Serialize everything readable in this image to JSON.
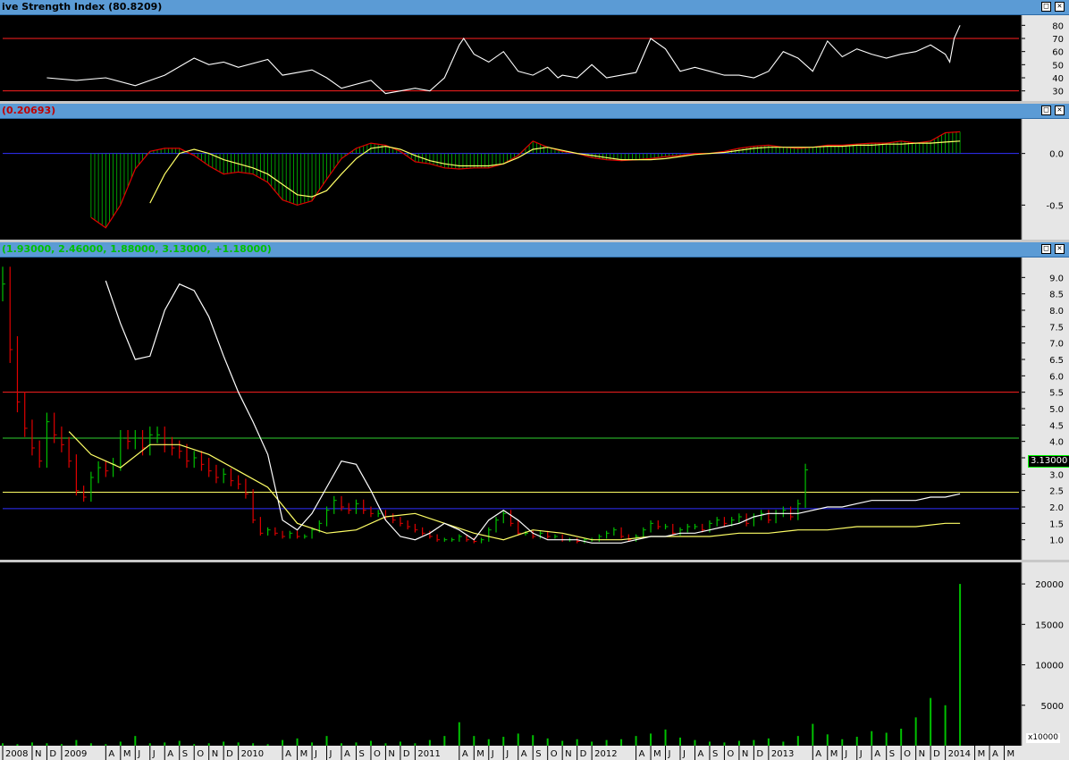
{
  "panes": {
    "rsi": {
      "title": "ive Strength Index",
      "value": "(80.8209)",
      "title_color": "#000000",
      "value_color": "#000000"
    },
    "macd": {
      "title": "",
      "value": "(0.20693)",
      "value_color": "#c00000"
    },
    "price": {
      "title": "",
      "value": "(1.93000, 2.46000, 1.88000, 3.13000, +1.18000)",
      "value_color": "#00c000",
      "last_price": "3.13000"
    },
    "volume": {
      "scale_label": "x10000"
    }
  },
  "window_buttons": {
    "maximize": "□",
    "close": "✕"
  },
  "colors": {
    "background": "#000000",
    "titlebar": "#5b9bd5",
    "up": "#00c000",
    "down": "#e00000",
    "ma_short": "#ffff66",
    "ma_long": "#ffffff",
    "macd": "#e00000",
    "signal": "#ffff66",
    "hist": "#00c000",
    "zero": "#3030ff",
    "guide_red": "#ff2020",
    "guide_green": "#30d030",
    "guide_yellow": "#ffff66",
    "guide_blue": "#3030ff"
  },
  "x_axis": {
    "labels": [
      "2008",
      "N",
      "D",
      "2009",
      "A",
      "M",
      "J",
      "J",
      "A",
      "S",
      "O",
      "N",
      "D",
      "2010",
      "A",
      "M",
      "J",
      "J",
      "A",
      "S",
      "O",
      "N",
      "D",
      "2011",
      "A",
      "M",
      "J",
      "J",
      "A",
      "S",
      "O",
      "N",
      "D",
      "2012",
      "A",
      "M",
      "J",
      "J",
      "A",
      "S",
      "O",
      "N",
      "D",
      "2013",
      "A",
      "M",
      "J",
      "J",
      "A",
      "S",
      "O",
      "N",
      "D",
      "2014",
      "M",
      "A",
      "M"
    ],
    "units": [
      0,
      2,
      3,
      4,
      7,
      8,
      9,
      10,
      11,
      12,
      13,
      14,
      15,
      16,
      19,
      20,
      21,
      22,
      23,
      24,
      25,
      26,
      27,
      28,
      31,
      32,
      33,
      34,
      35,
      36,
      37,
      38,
      39,
      40,
      43,
      44,
      45,
      46,
      47,
      48,
      49,
      50,
      51,
      52,
      55,
      56,
      57,
      58,
      59,
      60,
      61,
      62,
      63,
      64,
      66,
      67,
      68
    ]
  },
  "chart_data": [
    {
      "type": "line",
      "name": "Relative Strength Index",
      "ylim": [
        25,
        85
      ],
      "y_ticks": [
        30,
        40,
        50,
        60,
        70,
        80
      ],
      "levels": [
        30,
        70
      ],
      "x_range": [
        0,
        69
      ],
      "series": [
        {
          "x": [
            3,
            5,
            7,
            9,
            11,
            13,
            14,
            15,
            16,
            18,
            19,
            21,
            22,
            23,
            25,
            26,
            27,
            28,
            29,
            30,
            31,
            31.3,
            32,
            33,
            34,
            35,
            36,
            37,
            37.7,
            38,
            39,
            40,
            41,
            42,
            43,
            44,
            45,
            46,
            47,
            48,
            49,
            50,
            51,
            52,
            53,
            54,
            55,
            56,
            57,
            58,
            59,
            60,
            61,
            62,
            63,
            64,
            64.3,
            64.6,
            65
          ],
          "y": [
            40,
            38,
            40,
            34,
            42,
            55,
            50,
            52,
            48,
            54,
            42,
            46,
            40,
            32,
            38,
            28,
            30,
            32,
            30,
            40,
            65,
            70,
            58,
            52,
            60,
            45,
            42,
            48,
            40,
            42,
            40,
            50,
            40,
            42,
            44,
            70,
            62,
            45,
            48,
            45,
            42,
            42,
            40,
            45,
            60,
            55,
            45,
            68,
            56,
            62,
            58,
            55,
            58,
            60,
            65,
            58,
            52,
            70,
            80
          ]
        }
      ]
    },
    {
      "type": "line",
      "name": "MACD",
      "ylim": [
        -0.8,
        0.3
      ],
      "y_ticks": [
        -0.5,
        0.0
      ],
      "zero": 0,
      "x_range": [
        0,
        69
      ],
      "macd": {
        "x": [
          6,
          7,
          8,
          9,
          10,
          11,
          12,
          13,
          14,
          15,
          16,
          17,
          18,
          19,
          20,
          21,
          22,
          23,
          24,
          25,
          26,
          27,
          28,
          29,
          30,
          31,
          32,
          33,
          34,
          35,
          36,
          37,
          38,
          39,
          40,
          41,
          42,
          43,
          44,
          45,
          46,
          47,
          48,
          49,
          50,
          51,
          52,
          53,
          54,
          55,
          56,
          57,
          58,
          59,
          60,
          61,
          62,
          63,
          64,
          65
        ],
        "y": [
          -0.62,
          -0.72,
          -0.5,
          -0.15,
          0.02,
          0.05,
          0.05,
          -0.02,
          -0.12,
          -0.2,
          -0.18,
          -0.2,
          -0.28,
          -0.45,
          -0.5,
          -0.46,
          -0.25,
          -0.05,
          0.05,
          0.1,
          0.08,
          0.02,
          -0.08,
          -0.1,
          -0.14,
          -0.15,
          -0.14,
          -0.14,
          -0.1,
          -0.02,
          0.12,
          0.06,
          0.02,
          0.0,
          -0.04,
          -0.06,
          -0.07,
          -0.06,
          -0.05,
          -0.03,
          -0.02,
          0.0,
          0.0,
          0.02,
          0.05,
          0.07,
          0.08,
          0.06,
          0.05,
          0.06,
          0.08,
          0.08,
          0.09,
          0.1,
          0.1,
          0.12,
          0.1,
          0.12,
          0.2,
          0.21
        ]
      },
      "signal": {
        "x": [
          10,
          11,
          12,
          13,
          14,
          15,
          16,
          17,
          18,
          19,
          20,
          21,
          22,
          23,
          24,
          25,
          26,
          27,
          28,
          29,
          30,
          31,
          32,
          33,
          34,
          35,
          36,
          37,
          38,
          39,
          40,
          41,
          42,
          43,
          44,
          45,
          46,
          47,
          48,
          49,
          50,
          51,
          52,
          53,
          54,
          55,
          56,
          57,
          58,
          59,
          60,
          61,
          62,
          63,
          64,
          65
        ],
        "y": [
          -0.48,
          -0.2,
          0.0,
          0.04,
          0.0,
          -0.06,
          -0.1,
          -0.14,
          -0.2,
          -0.3,
          -0.4,
          -0.42,
          -0.36,
          -0.2,
          -0.05,
          0.05,
          0.07,
          0.04,
          -0.02,
          -0.07,
          -0.1,
          -0.12,
          -0.12,
          -0.12,
          -0.1,
          -0.04,
          0.04,
          0.06,
          0.03,
          0.0,
          -0.02,
          -0.04,
          -0.06,
          -0.06,
          -0.06,
          -0.05,
          -0.03,
          -0.01,
          0.0,
          0.01,
          0.03,
          0.05,
          0.06,
          0.06,
          0.06,
          0.06,
          0.07,
          0.07,
          0.08,
          0.08,
          0.09,
          0.09,
          0.1,
          0.1,
          0.11,
          0.12
        ]
      }
    },
    {
      "type": "bar",
      "name": "Price OHLC",
      "ylim": [
        0.5,
        9.5
      ],
      "y_ticks": [
        1.0,
        1.5,
        2.0,
        2.5,
        3.0,
        3.5,
        4.0,
        4.5,
        5.0,
        5.5,
        6.0,
        6.5,
        7.0,
        7.5,
        8.0,
        8.5,
        9.0
      ],
      "levels": {
        "red": 5.5,
        "green": 4.1,
        "yellow": 2.45,
        "blue": 1.95
      },
      "x_range": [
        0,
        69
      ],
      "candles": {
        "x": [
          0,
          0.5,
          1,
          1.5,
          2,
          2.5,
          3,
          3.5,
          4,
          4.5,
          5,
          5.5,
          6,
          6.5,
          7,
          7.5,
          8,
          8.5,
          9,
          9.5,
          10,
          10.5,
          11,
          11.5,
          12,
          12.5,
          13,
          13.5,
          14,
          14.5,
          15,
          15.5,
          16,
          16.5,
          17,
          17.5,
          18,
          18.5,
          19,
          19.5,
          20,
          20.5,
          21,
          21.5,
          22,
          22.5,
          23,
          23.5,
          24,
          24.5,
          25,
          25.5,
          26,
          26.5,
          27,
          27.5,
          28,
          28.5,
          29,
          29.5,
          30,
          30.5,
          31,
          31.5,
          32,
          32.5,
          33,
          33.5,
          34,
          34.5,
          35,
          35.5,
          36,
          36.5,
          37,
          37.5,
          38,
          38.5,
          39,
          39.5,
          40,
          40.5,
          41,
          41.5,
          42,
          42.5,
          43,
          43.5,
          44,
          44.5,
          45,
          45.5,
          46,
          46.5,
          47,
          47.5,
          48,
          48.5,
          49,
          49.5,
          50,
          50.5,
          51,
          51.5,
          52,
          52.5,
          53,
          53.5,
          54,
          54.5,
          55,
          55.5,
          56,
          56.5,
          57,
          57.5,
          58,
          58.5,
          59,
          59.5,
          60,
          60.5,
          61,
          61.5,
          62,
          62.5,
          63,
          63.5,
          64,
          64.5,
          65
        ],
        "close": [
          8.8,
          6.8,
          5.2,
          4.4,
          3.8,
          3.4,
          4.6,
          4.2,
          3.9,
          3.4,
          2.5,
          2.3,
          2.9,
          3.2,
          3.1,
          3.3,
          4.1,
          4.0,
          4.1,
          3.8,
          4.2,
          4.2,
          3.9,
          3.8,
          3.7,
          3.4,
          3.5,
          3.3,
          3.1,
          2.9,
          3.0,
          2.8,
          2.7,
          2.4,
          1.6,
          1.2,
          1.3,
          1.2,
          1.1,
          1.2,
          1.1,
          1.1,
          1.3,
          1.5,
          1.9,
          2.2,
          2.0,
          1.9,
          2.1,
          1.9,
          1.8,
          1.8,
          1.7,
          1.6,
          1.5,
          1.4,
          1.3,
          1.2,
          1.1,
          1.0,
          1.0,
          1.0,
          1.1,
          1.0,
          0.95,
          1.0,
          1.3,
          1.6,
          1.8,
          1.5,
          1.2,
          1.2,
          1.1,
          1.2,
          1.1,
          1.1,
          1.0,
          1.0,
          0.95,
          1.0,
          1.0,
          1.1,
          1.2,
          1.3,
          1.1,
          1.0,
          1.1,
          1.3,
          1.5,
          1.4,
          1.4,
          1.2,
          1.3,
          1.4,
          1.4,
          1.3,
          1.5,
          1.6,
          1.5,
          1.6,
          1.7,
          1.5,
          1.7,
          1.8,
          1.6,
          1.8,
          1.9,
          1.7,
          2.1,
          3.13,
          1.0,
          1.0,
          1.0,
          1.0,
          1.0,
          1.0,
          1.0,
          1.0,
          1.0,
          1.0,
          1.0,
          1.0,
          1.0,
          1.0,
          1.0,
          1.0,
          1.0,
          1.0,
          1.0,
          1.0,
          1.0
        ],
        "count": 110
      },
      "ma_short": {
        "x": [
          4.5,
          6,
          8,
          10,
          12,
          14,
          16,
          18,
          20,
          22,
          24,
          26,
          28,
          30,
          32,
          34,
          36,
          38,
          40,
          42,
          44,
          46,
          48,
          50,
          52,
          54,
          56,
          58,
          60,
          62,
          64,
          65
        ],
        "y": [
          4.3,
          3.6,
          3.2,
          3.9,
          3.9,
          3.6,
          3.1,
          2.6,
          1.5,
          1.2,
          1.3,
          1.7,
          1.8,
          1.5,
          1.2,
          1.0,
          1.3,
          1.2,
          1.0,
          1.0,
          1.1,
          1.1,
          1.1,
          1.2,
          1.2,
          1.3,
          1.3,
          1.4,
          1.4,
          1.4,
          1.5,
          1.5
        ]
      },
      "ma_long": {
        "x": [
          7,
          8,
          9,
          10,
          11,
          12,
          13,
          14,
          15,
          16,
          17,
          18,
          19,
          20,
          21,
          22,
          23,
          24,
          25,
          26,
          27,
          28,
          29,
          30,
          31,
          32,
          33,
          34,
          35,
          36,
          37,
          38,
          39,
          40,
          41,
          42,
          43,
          44,
          45,
          46,
          47,
          48,
          49,
          50,
          51,
          52,
          53,
          54,
          55,
          56,
          57,
          58,
          59,
          60,
          61,
          62,
          63,
          64,
          65
        ],
        "y": [
          8.9,
          7.6,
          6.5,
          6.6,
          8.0,
          8.8,
          8.6,
          7.8,
          6.6,
          5.5,
          4.6,
          3.6,
          1.6,
          1.3,
          1.8,
          2.6,
          3.4,
          3.3,
          2.5,
          1.6,
          1.1,
          1.0,
          1.2,
          1.5,
          1.3,
          1.0,
          1.6,
          1.9,
          1.6,
          1.2,
          1.0,
          1.0,
          1.0,
          0.9,
          0.9,
          0.9,
          1.0,
          1.1,
          1.1,
          1.2,
          1.2,
          1.3,
          1.4,
          1.5,
          1.7,
          1.8,
          1.8,
          1.8,
          1.9,
          2.0,
          2.0,
          2.1,
          2.2,
          2.2,
          2.2,
          2.2,
          2.3,
          2.3,
          2.4
        ]
      }
    },
    {
      "type": "bar",
      "name": "Volume",
      "ylim": [
        0,
        22000
      ],
      "y_ticks": [
        5000,
        10000,
        15000,
        20000
      ],
      "x_range": [
        0,
        69
      ],
      "bars": {
        "x": [
          0,
          1,
          2,
          3,
          4,
          5,
          6,
          7,
          8,
          9,
          10,
          11,
          12,
          13,
          14,
          15,
          16,
          17,
          18,
          19,
          20,
          21,
          22,
          23,
          24,
          25,
          26,
          27,
          28,
          29,
          30,
          31,
          32,
          33,
          34,
          35,
          36,
          37,
          38,
          39,
          40,
          41,
          42,
          43,
          44,
          45,
          46,
          47,
          48,
          49,
          50,
          51,
          52,
          53,
          54,
          55,
          56,
          57,
          58,
          59,
          60,
          61,
          62,
          63,
          64,
          65
        ],
        "y": [
          300,
          200,
          400,
          300,
          200,
          700,
          300,
          200,
          500,
          1200,
          300,
          400,
          600,
          200,
          300,
          500,
          400,
          300,
          200,
          700,
          900,
          400,
          1200,
          300,
          400,
          600,
          300,
          500,
          300,
          700,
          1200,
          2900,
          1200,
          800,
          1100,
          1500,
          1300,
          900,
          600,
          800,
          500,
          700,
          800,
          1200,
          1500,
          2000,
          1000,
          700,
          500,
          400,
          600,
          700,
          900,
          500,
          1200,
          2700,
          1400,
          800,
          1100,
          1800,
          1600,
          2100,
          3500,
          5900,
          5000,
          20000
        ]
      }
    }
  ]
}
